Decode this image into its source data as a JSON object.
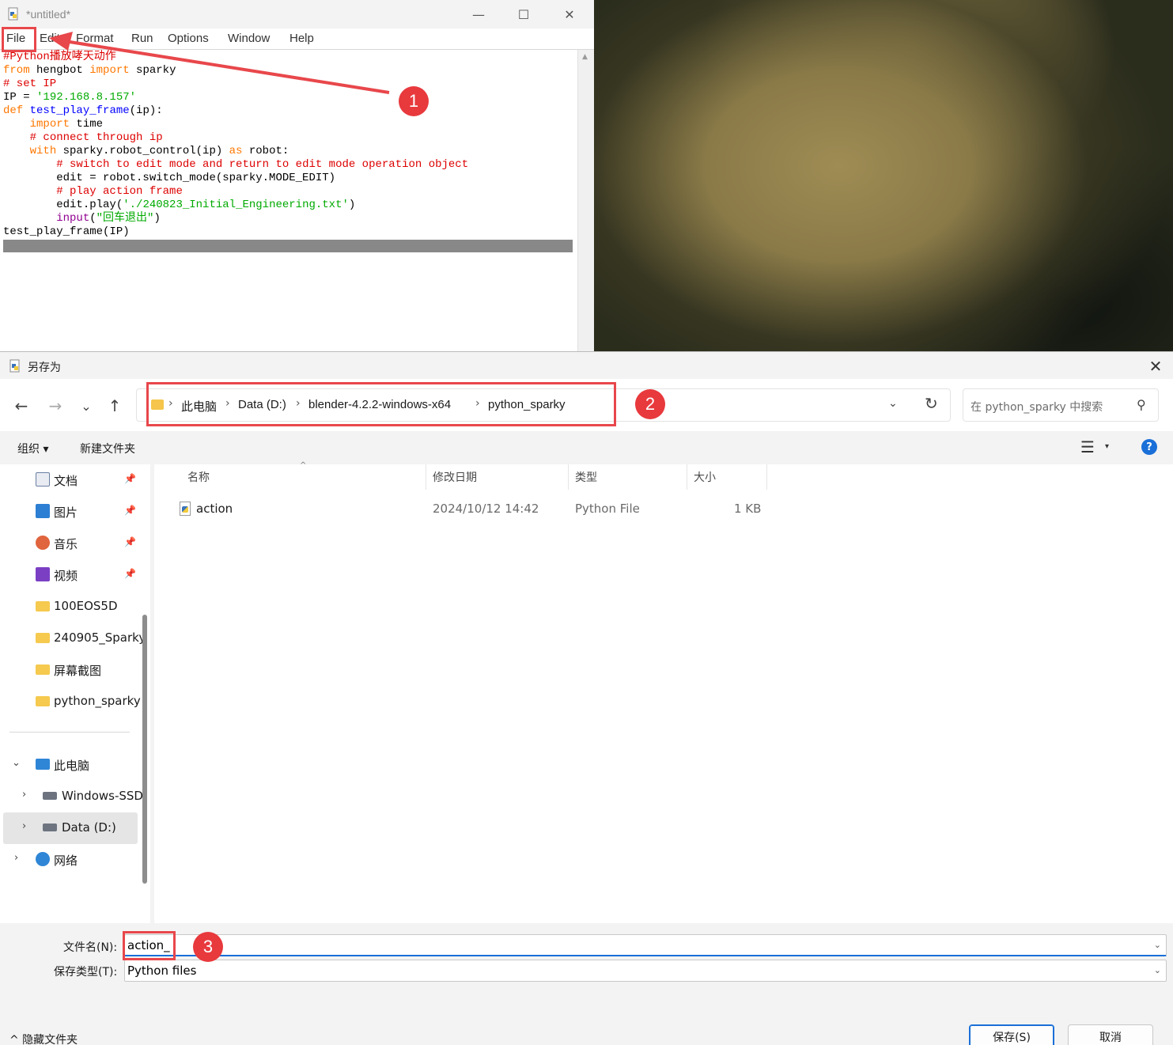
{
  "idle": {
    "title": "*untitled*",
    "window_buttons": {
      "minimize": "—",
      "maximize": "☐",
      "close": "✕"
    },
    "menu": [
      "File",
      "Edit",
      "Format",
      "Run",
      "Options",
      "Window",
      "Help"
    ],
    "code": {
      "l1": "#Python播放哮天动作",
      "l2a": "from",
      "l2b": " hengbot ",
      "l2c": "import",
      "l2d": " sparky",
      "l3": "# set IP",
      "l4a": "IP = ",
      "l4b": "'192.168.8.157'",
      "l5a": "def",
      "l5b": " ",
      "l5c": "test_play_frame",
      "l5d": "(ip):",
      "l6a": "    ",
      "l6b": "import",
      "l6c": " time",
      "l7a": "    ",
      "l7b": "# connect through ip",
      "l8a": "    ",
      "l8b": "with",
      "l8c": " sparky.robot_control(ip) ",
      "l8d": "as",
      "l8e": " robot:",
      "l9a": "        ",
      "l9b": "# switch to edit mode and return to edit mode operation object",
      "l10": "        edit = robot.switch_mode(sparky.MODE_EDIT)",
      "l11a": "        ",
      "l11b": "# play action frame",
      "l12a": "        edit.play(",
      "l12b": "'./240823_Initial_Engineering.txt'",
      "l12c": ")",
      "l13a": "        ",
      "l13b": "input",
      "l13c": "(",
      "l13d": "\"回车退出\"",
      "l13e": ")",
      "l14": "test_play_frame(IP)"
    }
  },
  "dialog": {
    "title": "另存为",
    "close": "✕",
    "nav": {
      "back": "←",
      "forward": "→",
      "recent": "⌄",
      "up": "↑"
    },
    "breadcrumb": [
      "此电脑",
      "Data (D:)",
      "blender-4.2.2-windows-x64",
      "python_sparky"
    ],
    "breadcrumb_sep": "›",
    "address_dropdown": "⌄",
    "refresh": "↻",
    "search_placeholder": "在 python_sparky 中搜索",
    "search_icon": "⚲",
    "commands": {
      "organize": "组织 ▾",
      "new_folder": "新建文件夹"
    },
    "view_icon": "☰",
    "view_arrow": "▾",
    "help": "?",
    "sidebar": {
      "quick": [
        {
          "label": "文档",
          "icon": "document-icon",
          "color": "#6b7fa3"
        },
        {
          "label": "图片",
          "icon": "pictures-icon",
          "color": "#2d7fd3"
        },
        {
          "label": "音乐",
          "icon": "music-icon",
          "color": "#e0643d"
        },
        {
          "label": "视频",
          "icon": "video-icon",
          "color": "#7b3fc4"
        }
      ],
      "pin": "📌",
      "folders": [
        "100EOS5D",
        "240905_Sparky",
        "屏幕截图",
        "python_sparky"
      ],
      "this_pc": "此电脑",
      "drives": [
        "Windows-SSD",
        "Data (D:)"
      ],
      "network": "网络",
      "expand_open": "⌄",
      "expand_closed": "›"
    },
    "columns": {
      "name": "名称",
      "modified": "修改日期",
      "type": "类型",
      "size": "大小"
    },
    "sort_indicator": "^",
    "files": [
      {
        "name": "action",
        "modified": "2024/10/12 14:42",
        "type": "Python File",
        "size": "1 KB"
      }
    ],
    "filename_label": "文件名(N):",
    "filename_value": "action_",
    "filetype_label": "保存类型(T):",
    "filetype_value": "Python files",
    "dropdown": "⌄",
    "hide_folders": "^ 隐藏文件夹",
    "save": "保存(S)",
    "cancel": "取消"
  },
  "annotations": {
    "step1": "1",
    "step2": "2",
    "step3": "3",
    "color": "#e8393d"
  }
}
